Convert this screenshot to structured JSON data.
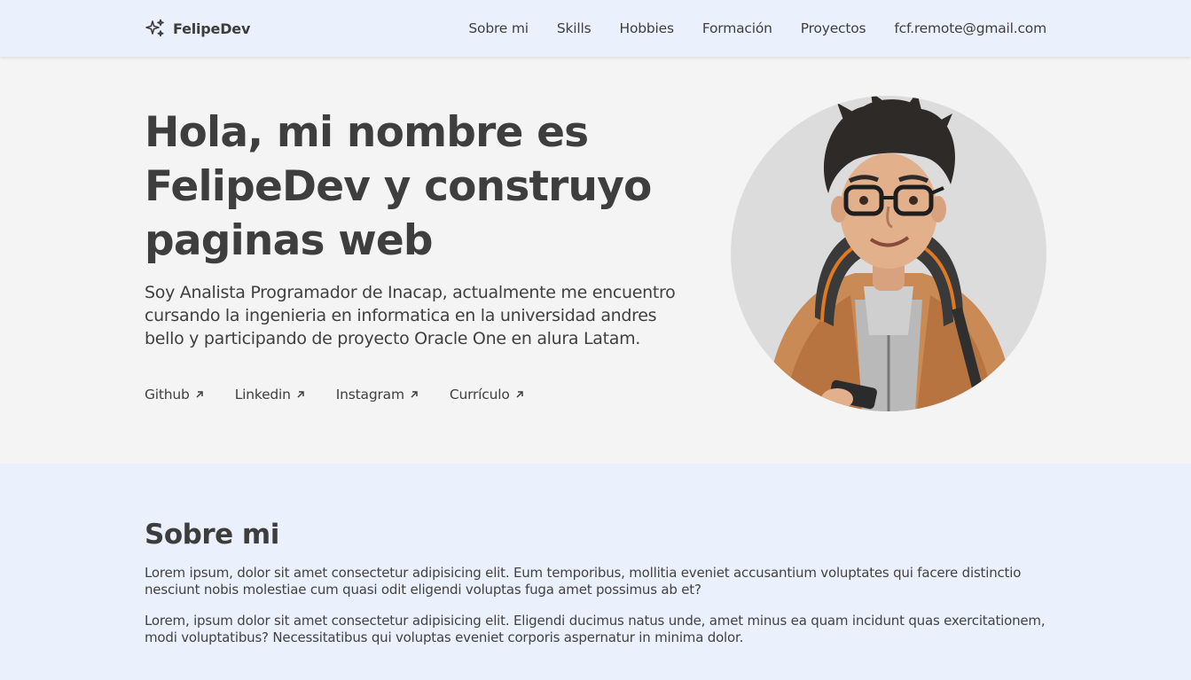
{
  "nav": {
    "brand": "FelipeDev",
    "brand_icon": "sparkles-icon",
    "links": [
      "Sobre mi",
      "Skills",
      "Hobbies",
      "Formación",
      "Proyectos",
      "fcf.remote@gmail.com"
    ]
  },
  "hero": {
    "title": "Hola, mi nombre es FelipeDev y construyo paginas web",
    "description": "Soy Analista Programador de Inacap, actualmente me encuentro cursando la ingenieria en informatica en la universidad andres bello y participando de proyecto Oracle One en alura Latam.",
    "links": [
      "Github",
      "Linkedin",
      "Instagram",
      "Currículo"
    ],
    "link_icon": "arrow-up-right-icon",
    "avatar": "avatar"
  },
  "about": {
    "title": "Sobre mi",
    "paragraphs": [
      "Lorem ipsum, dolor sit amet consectetur adipisicing elit. Eum temporibus, mollitia eveniet accusantium voluptates qui facere distinctio nesciunt nobis molestiae cum quasi odit eligendi voluptas fuga amet possimus ab et?",
      "Lorem, ipsum dolor sit amet consectetur adipisicing elit. Eligendi ducimus natus unde, amet minus ea quam incidunt quas exercitationem, modi voluptatibus? Necessitatibus qui voluptas eveniet corporis aspernatur in minima dolor."
    ]
  },
  "colors": {
    "nav_bg": "#eaf1fc",
    "hero_bg": "#f4f4f4",
    "text": "#404040",
    "avatar_bg": "#dcdcdc"
  }
}
